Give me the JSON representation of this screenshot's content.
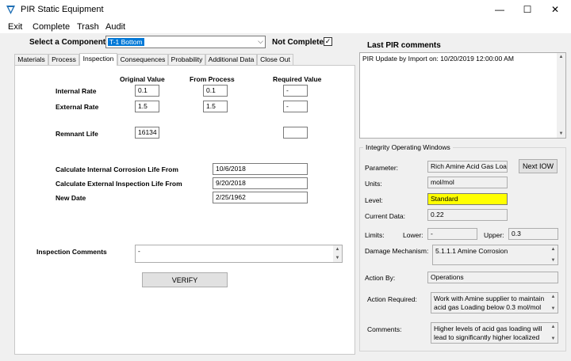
{
  "window": {
    "title": "PIR Static Equipment",
    "minimize": "—",
    "maximize": "☐",
    "close": "✕"
  },
  "menu": [
    "Exit",
    "Complete",
    "Trash",
    "Audit"
  ],
  "component": {
    "label": "Select a Component",
    "value": "T-1 Bottom",
    "not_complete_label": "Not Complete",
    "not_complete_checked": true,
    "check_glyph": "✓"
  },
  "tabs": [
    "Materials",
    "Process",
    "Inspection",
    "Consequences",
    "Probability",
    "Additional Data",
    "Close Out"
  ],
  "active_tab": "Inspection",
  "inspection": {
    "col_headers": {
      "original": "Original Value",
      "process": "From Process",
      "required": "Required Value"
    },
    "internal_rate": {
      "label": "Internal Rate",
      "original": "0.1",
      "process": "0.1",
      "required": "-"
    },
    "external_rate": {
      "label": "External Rate",
      "original": "1.5",
      "process": "1.5",
      "required": "-"
    },
    "remnant_life": {
      "label": "Remnant Life",
      "original": "16134",
      "required": ""
    },
    "calc_internal": {
      "label": "Calculate Internal Corrosion Life From",
      "value": "10/6/2018"
    },
    "calc_external": {
      "label": "Calculate External Inspection Life From",
      "value": "9/20/2018"
    },
    "new_date": {
      "label": "New Date",
      "value": "2/25/1962"
    },
    "comments": {
      "label": "Inspection Comments",
      "value": "-"
    },
    "verify_label": "VERIFY"
  },
  "last_pir": {
    "heading": "Last PIR comments",
    "text": "PIR Update by Import on: 10/20/2019 12:00:00 AM"
  },
  "iow": {
    "group_title": "Integrity Operating Windows",
    "parameter": {
      "label": "Parameter:",
      "value": "Rich Amine Acid Gas Loa"
    },
    "next_label": "Next IOW",
    "units": {
      "label": "Units:",
      "value": "mol/mol"
    },
    "level": {
      "label": "Level:",
      "value": "Standard"
    },
    "current": {
      "label": "Current Data:",
      "value": "0.22"
    },
    "limits": {
      "label": "Limits:",
      "lower_label": "Lower:",
      "lower": "-",
      "upper_label": "Upper:",
      "upper": "0.3"
    },
    "damage": {
      "label": "Damage Mechanism:",
      "value": "5.1.1.1 Amine Corrosion"
    },
    "action_by": {
      "label": "Action By:",
      "value": "Operations"
    },
    "action_required": {
      "label": "Action Required:",
      "value": "Work with Amine supplier to maintain acid gas Loading below 0.3 mol/mol"
    },
    "comments": {
      "label": "Comments:",
      "value": "Higher levels of acid gas loading will lead to significantly higher localized"
    }
  },
  "colors": {
    "accent": "#0078d7",
    "highlight": "#ffff00",
    "window_bg": "#f0f0f0"
  },
  "glyphs": {
    "dropdown": "⌵",
    "scroll_up": "▲",
    "scroll_down": "▼"
  }
}
